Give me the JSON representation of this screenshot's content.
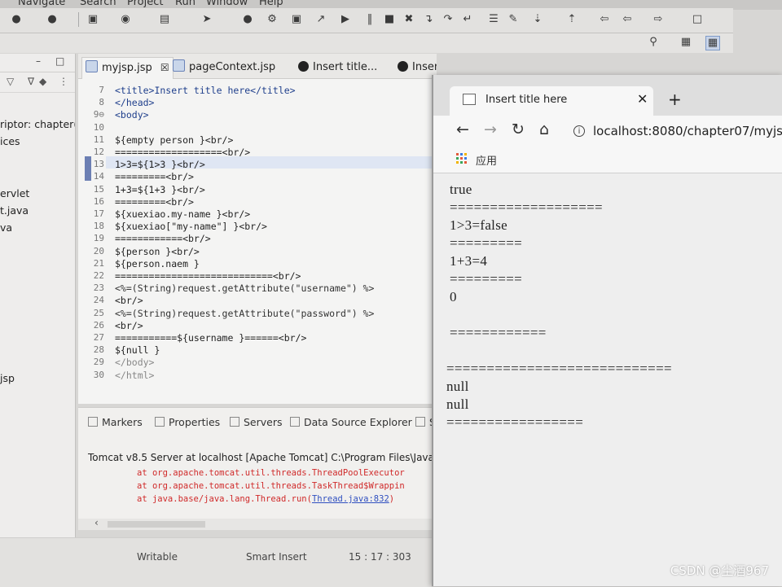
{
  "menu": [
    "Navigate",
    "Search",
    "Project",
    "Run",
    "Window",
    "Help"
  ],
  "explorer": {
    "items": [
      "riptor: chapter(",
      "ices",
      "ervlet",
      "t.java",
      "va",
      "jsp"
    ]
  },
  "editor": {
    "tabs": [
      "myjsp.jsp",
      "pageContext.jsp",
      "Insert title...",
      "Insert"
    ],
    "lines": [
      {
        "n": "7",
        "t": "<title>Insert title here</title>"
      },
      {
        "n": "8",
        "t": "</head>"
      },
      {
        "n": "9⊖",
        "t": "<body>"
      },
      {
        "n": "10",
        "t": ""
      },
      {
        "n": "11",
        "t": "${empty person }<br/>"
      },
      {
        "n": "12",
        "t": "===================<br/>"
      },
      {
        "n": "13",
        "t": "1>3=${1>3 }<br/>"
      },
      {
        "n": "14",
        "t": "=========<br/>"
      },
      {
        "n": "15",
        "t": "1+3=${1+3 }<br/>"
      },
      {
        "n": "16",
        "t": "=========<br/>"
      },
      {
        "n": "17",
        "t": "${xuexiao.my-name }<br/>"
      },
      {
        "n": "18",
        "t": "${xuexiao[\"my-name\"] }<br/>"
      },
      {
        "n": "19",
        "t": "============<br/>"
      },
      {
        "n": "20",
        "t": "${person }<br/>"
      },
      {
        "n": "21",
        "t": "${person.naem }"
      },
      {
        "n": "22",
        "t": "============================<br/>"
      },
      {
        "n": "23",
        "t": "<%=(String)request.getAttribute(\"username\") %>"
      },
      {
        "n": "24",
        "t": "<br/>"
      },
      {
        "n": "25",
        "t": "<%=(String)request.getAttribute(\"password\") %>"
      },
      {
        "n": "26",
        "t": "<br/>"
      },
      {
        "n": "27",
        "t": "===========${username }======<br/>"
      },
      {
        "n": "28",
        "t": "${null }"
      },
      {
        "n": "29",
        "t": "</body>"
      },
      {
        "n": "30",
        "t": "</html>"
      }
    ]
  },
  "panel": {
    "tabs": [
      "Markers",
      "Properties",
      "Servers",
      "Data Source Explorer",
      "S"
    ],
    "console_title": "Tomcat v8.5 Server at localhost [Apache Tomcat] C:\\Program Files\\Java\\j",
    "errors": [
      "at org.apache.tomcat.util.threads.ThreadPoolExecutor",
      "at org.apache.tomcat.util.threads.TaskThread$Wrappin",
      "at java.base/java.lang.Thread.run("
    ],
    "error_link": "Thread.java:832",
    "error_tail": ")"
  },
  "status": {
    "mode": "Writable",
    "insert": "Smart Insert",
    "position": "15 : 17 : 303"
  },
  "browser": {
    "tab_title": "Insert title here",
    "url": "localhost:8080/chapter07/myjsp.jsp",
    "bookmark_apps": "应用",
    "output": [
      "true",
      "===================",
      "1>3=false",
      "=========",
      "1+3=4",
      "=========",
      "0",
      "",
      "============",
      "",
      "============================",
      "null",
      "null",
      "================="
    ]
  },
  "watermark": "CSDN @尘酒967"
}
